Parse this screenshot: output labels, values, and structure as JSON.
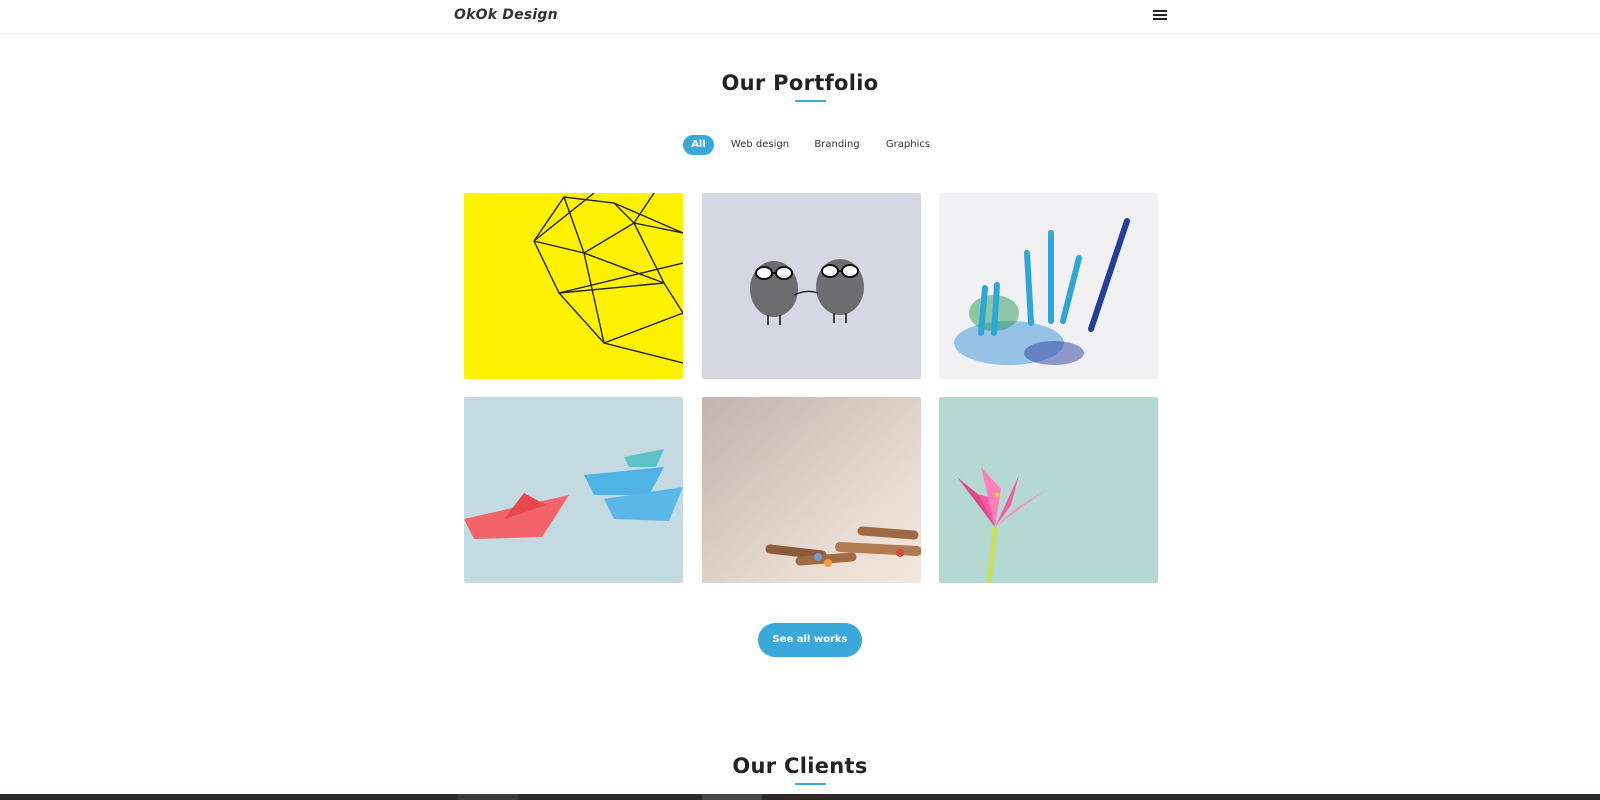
{
  "nav": {
    "brand": "OkOk Design",
    "menu_icon": "hamburger-icon"
  },
  "portfolio": {
    "title": "Our Portfolio",
    "filters": [
      {
        "label": "All",
        "active": true
      },
      {
        "label": "Web design",
        "active": false
      },
      {
        "label": "Branding",
        "active": false
      },
      {
        "label": "Graphics",
        "active": false
      }
    ],
    "items": [
      {
        "image": "wire-geometric-shape-on-yellow"
      },
      {
        "image": "pebbles-with-glasses-holding-hands"
      },
      {
        "image": "blue-colored-pencils-with-shavings"
      },
      {
        "image": "paper-boats-red-and-blue"
      },
      {
        "image": "wooden-pencil-stubs"
      },
      {
        "image": "pink-origami-lily"
      }
    ],
    "cta_label": "See all works"
  },
  "clients": {
    "title": "Our Clients"
  },
  "colors": {
    "accent": "#3aa8d8",
    "text": "#222222",
    "background": "#ffffff"
  }
}
